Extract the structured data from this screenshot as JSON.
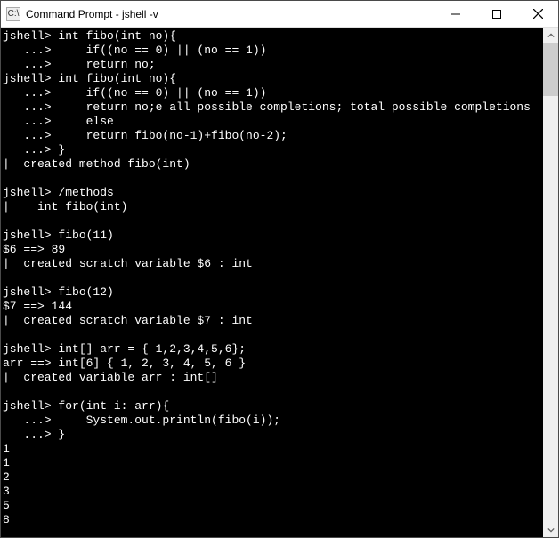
{
  "window": {
    "title": "Command Prompt - jshell  -v",
    "icon_label": "C:\\"
  },
  "terminal": {
    "lines": [
      "jshell> int fibo(int no){",
      "   ...>     if((no == 0) || (no == 1))",
      "   ...>     return no;",
      "jshell> int fibo(int no){",
      "   ...>     if((no == 0) || (no == 1))",
      "   ...>     return no;e all possible completions; total possible completions",
      "   ...>     else",
      "   ...>     return fibo(no-1)+fibo(no-2);",
      "   ...> }",
      "|  created method fibo(int)",
      "",
      "jshell> /methods",
      "|    int fibo(int)",
      "",
      "jshell> fibo(11)",
      "$6 ==> 89",
      "|  created scratch variable $6 : int",
      "",
      "jshell> fibo(12)",
      "$7 ==> 144",
      "|  created scratch variable $7 : int",
      "",
      "jshell> int[] arr = { 1,2,3,4,5,6};",
      "arr ==> int[6] { 1, 2, 3, 4, 5, 6 }",
      "|  created variable arr : int[]",
      "",
      "jshell> for(int i: arr){",
      "   ...>     System.out.println(fibo(i));",
      "   ...> }",
      "1",
      "1",
      "2",
      "3",
      "5",
      "8"
    ]
  }
}
